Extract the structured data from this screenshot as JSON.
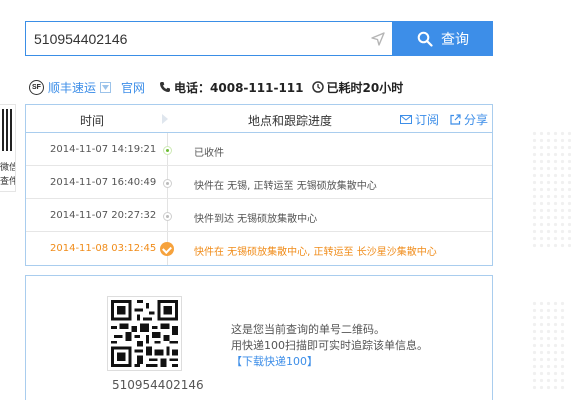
{
  "search": {
    "value": "510954402146",
    "button_label": "查询",
    "button_icon": "search-icon",
    "locate_icon": "send-location-icon"
  },
  "info": {
    "carrier_logo": "SF",
    "carrier": "顺丰速运",
    "official_site": "官网",
    "phone": "电话：4008-111-111",
    "elapsed": "已耗时20小时"
  },
  "left_panel": {
    "line1": "微信",
    "line2": "查件"
  },
  "table": {
    "header_time": "时间",
    "header_location": "地点和跟踪进度",
    "subscribe": "订阅",
    "share": "分享",
    "rows": [
      {
        "time": "2014-11-07 14:19:21",
        "desc": "已收件"
      },
      {
        "time": "2014-11-07 16:40:49",
        "desc": "快件在 无锡, 正转运至 无锡硕放集散中心"
      },
      {
        "time": "2014-11-07 20:27:32",
        "desc": "快件到达 无锡硕放集散中心"
      },
      {
        "time": "2014-11-08 03:12:45",
        "desc": "快件在 无锡硕放集散中心, 正转运至 长沙星沙集散中心"
      }
    ]
  },
  "qr": {
    "number": "510954402146",
    "line1": "这是您当前查询的单号二维码。",
    "line2": "用快递100扫描即可实时追踪该单信息。",
    "link": "【下载快递100】"
  },
  "colors": {
    "accent": "#3d8ee8",
    "border": "#a9cdee",
    "latest_status": "#f08c1a",
    "first_dot": "#6cbc32"
  }
}
